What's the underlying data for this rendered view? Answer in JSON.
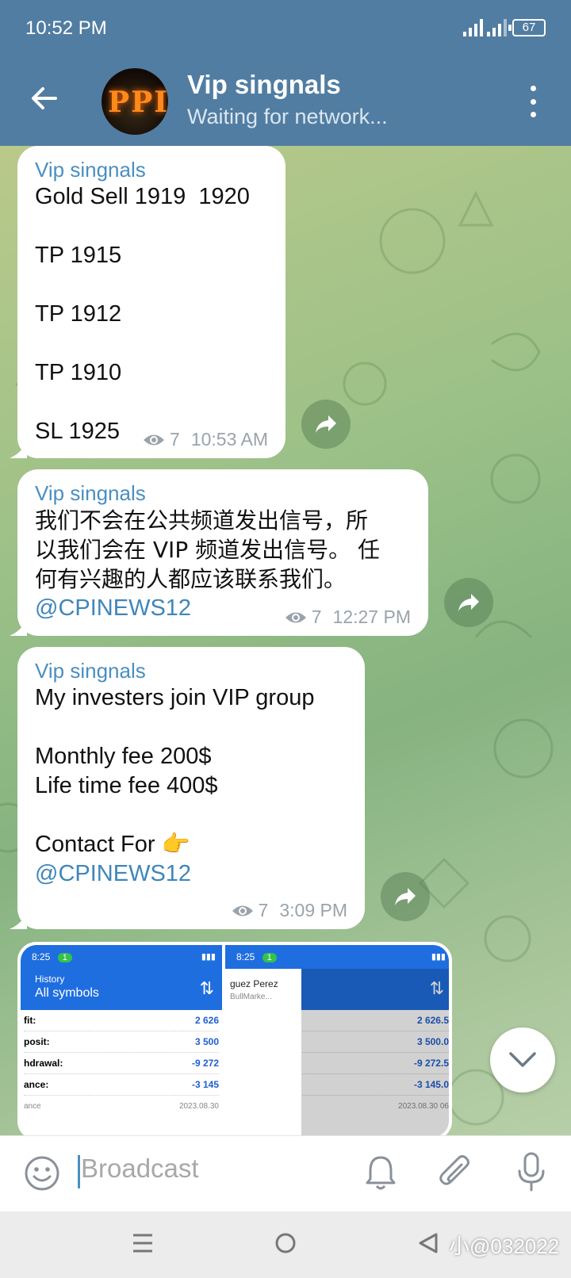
{
  "status": {
    "time": "10:52 PM",
    "battery": "67"
  },
  "header": {
    "title": "Vip singnals",
    "subtitle": "Waiting for network...",
    "avatar_text": "PPI"
  },
  "messages": [
    {
      "sender": "Vip singnals",
      "text": "Gold Sell 1919  1920\n\nTP 1915\n\nTP 1912\n\nTP 1910\n\nSL 1925",
      "link": "",
      "views": "7",
      "time": "10:53 AM"
    },
    {
      "sender": "Vip singnals",
      "text": "我们不会在公共频道发出信号，所\n以我们会在 VIP 频道发出信号。 任\n何有兴趣的人都应该联系我们。",
      "link": "@CPINEWS12",
      "views": "7",
      "time": "12:27 PM"
    },
    {
      "sender": "Vip singnals",
      "text": "My investers join VIP group\n\nMonthly fee 200$\nLife time fee 400$\n\nContact For 👉\n",
      "link": "@CPINEWS12",
      "views": "7",
      "time": "3:09 PM"
    }
  ],
  "media": {
    "left": {
      "time": "8:25",
      "badge": "1",
      "title_small": "History",
      "title": "All symbols",
      "rows": [
        {
          "label": "fit:",
          "value": "2 626"
        },
        {
          "label": "posit:",
          "value": "3 500"
        },
        {
          "label": "hdrawal:",
          "value": "-9 272"
        },
        {
          "label": "ance:",
          "value": "-3 145"
        }
      ],
      "last_label": "ance",
      "last_value": "2023.08.30"
    },
    "right": {
      "time": "8:25",
      "badge": "1",
      "popup_name": "guez Perez",
      "popup_sub": "BullMarke...",
      "rows": [
        {
          "label": "",
          "value": "2 626.5"
        },
        {
          "label": "",
          "value": "3 500.0"
        },
        {
          "label": "",
          "value": "-9 272.5"
        },
        {
          "label": "",
          "value": "-3 145.0"
        }
      ],
      "last_value": "2023.08.30 06"
    }
  },
  "input": {
    "placeholder": "Broadcast"
  },
  "watermark": "小@032022"
}
